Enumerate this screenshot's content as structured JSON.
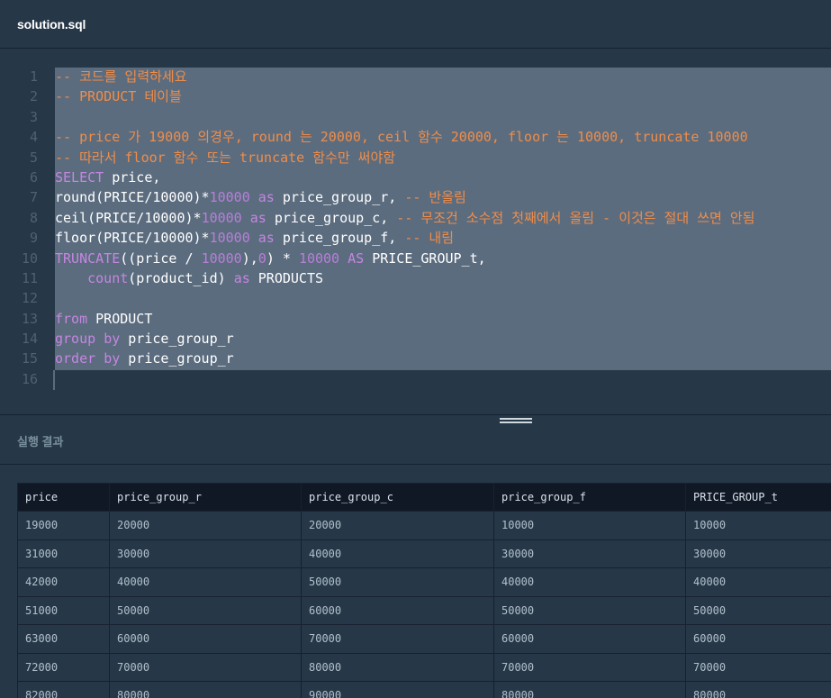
{
  "header": {
    "title": "solution.sql"
  },
  "editor": {
    "lines": [
      {
        "n": "1",
        "tokens": [
          {
            "t": "c",
            "v": "-- 코드를 입력하세요"
          }
        ]
      },
      {
        "n": "2",
        "tokens": [
          {
            "t": "c",
            "v": "-- PRODUCT 테이블"
          }
        ]
      },
      {
        "n": "3",
        "tokens": []
      },
      {
        "n": "4",
        "tokens": [
          {
            "t": "c",
            "v": "-- price 가 19000 의경우, round 는 20000, ceil 함수 20000, floor 는 10000, truncate 10000"
          }
        ]
      },
      {
        "n": "5",
        "tokens": [
          {
            "t": "c",
            "v": "-- 따라서 floor 함수 또는 truncate 함수만 써야함"
          }
        ]
      },
      {
        "n": "6",
        "tokens": [
          {
            "t": "k",
            "v": "SELECT"
          },
          {
            "t": "p",
            "v": " price,"
          }
        ]
      },
      {
        "n": "7",
        "tokens": [
          {
            "t": "p",
            "v": "round(PRICE/10000)*"
          },
          {
            "t": "n",
            "v": "10000"
          },
          {
            "t": "p",
            "v": " "
          },
          {
            "t": "k",
            "v": "as"
          },
          {
            "t": "p",
            "v": " price_group_r, "
          },
          {
            "t": "c",
            "v": "-- 반올림"
          }
        ]
      },
      {
        "n": "8",
        "tokens": [
          {
            "t": "p",
            "v": "ceil(PRICE/10000)*"
          },
          {
            "t": "n",
            "v": "10000"
          },
          {
            "t": "p",
            "v": " "
          },
          {
            "t": "k",
            "v": "as"
          },
          {
            "t": "p",
            "v": " price_group_c, "
          },
          {
            "t": "c",
            "v": "-- 무조건 소수점 첫째에서 올림 - 이것은 절대 쓰면 안됨"
          }
        ]
      },
      {
        "n": "9",
        "tokens": [
          {
            "t": "p",
            "v": "floor(PRICE/10000)*"
          },
          {
            "t": "n",
            "v": "10000"
          },
          {
            "t": "p",
            "v": " "
          },
          {
            "t": "k",
            "v": "as"
          },
          {
            "t": "p",
            "v": " price_group_f, "
          },
          {
            "t": "c",
            "v": "-- 내림"
          }
        ]
      },
      {
        "n": "10",
        "tokens": [
          {
            "t": "k",
            "v": "TRUNCATE"
          },
          {
            "t": "p",
            "v": "((price / "
          },
          {
            "t": "n",
            "v": "10000"
          },
          {
            "t": "p",
            "v": "),"
          },
          {
            "t": "n",
            "v": "0"
          },
          {
            "t": "p",
            "v": ") * "
          },
          {
            "t": "n",
            "v": "10000"
          },
          {
            "t": "p",
            "v": " "
          },
          {
            "t": "k",
            "v": "AS"
          },
          {
            "t": "p",
            "v": " PRICE_GROUP_t,"
          }
        ]
      },
      {
        "n": "11",
        "tokens": [
          {
            "t": "p",
            "v": "    "
          },
          {
            "t": "k",
            "v": "count"
          },
          {
            "t": "p",
            "v": "(product_id) "
          },
          {
            "t": "k",
            "v": "as"
          },
          {
            "t": "p",
            "v": " PRODUCTS"
          }
        ]
      },
      {
        "n": "12",
        "tokens": []
      },
      {
        "n": "13",
        "tokens": [
          {
            "t": "k",
            "v": "from"
          },
          {
            "t": "p",
            "v": " PRODUCT"
          }
        ]
      },
      {
        "n": "14",
        "tokens": [
          {
            "t": "k",
            "v": "group"
          },
          {
            "t": "p",
            "v": " "
          },
          {
            "t": "k",
            "v": "by"
          },
          {
            "t": "p",
            "v": " price_group_r"
          }
        ]
      },
      {
        "n": "15",
        "tokens": [
          {
            "t": "k",
            "v": "order"
          },
          {
            "t": "p",
            "v": " "
          },
          {
            "t": "k",
            "v": "by"
          },
          {
            "t": "p",
            "v": " price_group_r"
          }
        ]
      },
      {
        "n": "16",
        "tokens": []
      }
    ]
  },
  "result": {
    "label": "실행 결과",
    "columns": [
      "price",
      "price_group_r",
      "price_group_c",
      "price_group_f",
      "PRICE_GROUP_t"
    ],
    "rows": [
      [
        "19000",
        "20000",
        "20000",
        "10000",
        "10000"
      ],
      [
        "31000",
        "30000",
        "40000",
        "30000",
        "30000"
      ],
      [
        "42000",
        "40000",
        "50000",
        "40000",
        "40000"
      ],
      [
        "51000",
        "50000",
        "60000",
        "50000",
        "50000"
      ],
      [
        "63000",
        "60000",
        "70000",
        "60000",
        "60000"
      ],
      [
        "72000",
        "70000",
        "80000",
        "70000",
        "70000"
      ],
      [
        "82000",
        "80000",
        "90000",
        "80000",
        "80000"
      ]
    ]
  },
  "colors": {
    "background": "#263747",
    "comment": "#f08d49",
    "keyword": "#c586e0",
    "number": "#b87fd8",
    "selection": "#6a7b8f"
  }
}
